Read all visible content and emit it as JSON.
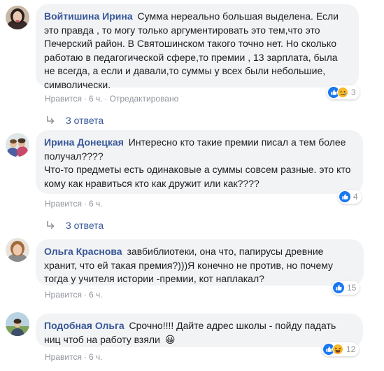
{
  "comments": [
    {
      "author": "Войтишина Ирина",
      "text": "Сумма нереально большая выделена. Если это правда , то могу только аргументировать это тем,что это Печерский район. В Святошинском такого точно нет. Но сколько работаю в педагогической сфере,то премии , 13 зарплата, была не всегда, а если и давали,то суммы у всех были небольшие, символически.",
      "like_label": "Нравится",
      "time": "6 ч.",
      "edited": "Отредактировано",
      "reactions": [
        "like-icon",
        "sad-icon"
      ],
      "reaction_count": "3",
      "replies_label": "3 ответа"
    },
    {
      "author": "Ирина Донецкая",
      "text": "Интересно кто такие премии писал а тем более получал????\nЧто-то предметы есть одинаковые а суммы совсем разные. это кто кому как нравиться кто как дружит или как????",
      "like_label": "Нравится",
      "time": "6 ч.",
      "reactions": [
        "like-icon"
      ],
      "reaction_count": "4",
      "replies_label": "3 ответа"
    },
    {
      "author": "Ольга Краснова",
      "text": "завбиблиотеки, она что, папирусы древние хранит, что ей такая премия?)))Я конечно не против, но почему тогда у учителя истории -премии, кот наплакал?",
      "like_label": "Нравится",
      "time": "6 ч.",
      "reactions": [
        "like-icon"
      ],
      "reaction_count": "15"
    },
    {
      "author": "Подобная Ольга",
      "text": "Срочно!!!! Дайте адрес школы - пойду падать ниц чтоб на работу взяли",
      "emoji": "😀",
      "like_label": "Нравится",
      "time": "6 ч.",
      "reactions": [
        "like-icon",
        "haha-icon"
      ],
      "reaction_count": "12"
    }
  ],
  "colors": {
    "author": "#385898",
    "bubble": "#f2f3f5",
    "meta": "#90949c",
    "like_blue": "#1877f2",
    "sad_yellow": "#f7b928"
  }
}
